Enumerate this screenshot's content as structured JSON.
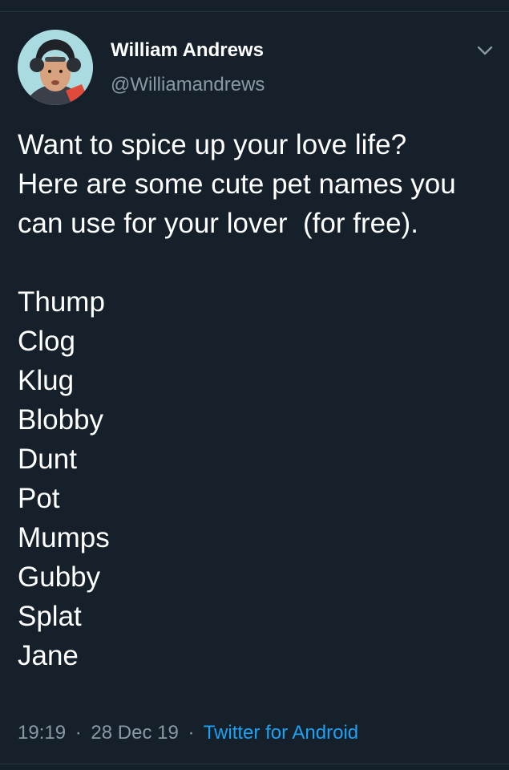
{
  "author": {
    "display_name": "William Andrews",
    "handle": "@Williamandrews",
    "avatar_icon": "profile-photo-avatar"
  },
  "tweet": {
    "intro": "Want to spice up your love life? Here are some cute pet names you can use for your lover  (for free).",
    "pet_names": [
      "Thump",
      "Clog",
      "Klug",
      "Blobby",
      "Dunt",
      "Pot",
      "Mumps",
      "Gubby",
      "Splat",
      "Jane"
    ]
  },
  "meta": {
    "time": "19:19",
    "separator": "·",
    "date": "28 Dec 19",
    "source": "Twitter for Android"
  },
  "icons": {
    "menu": "chevron-down-icon"
  },
  "colors": {
    "background": "#15202b",
    "text": "#ffffff",
    "secondary_text": "#8899a6",
    "link": "#1da1f2"
  }
}
